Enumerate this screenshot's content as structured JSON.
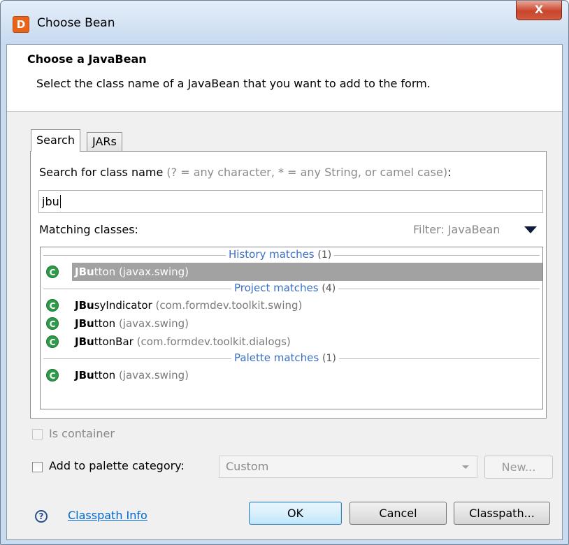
{
  "window": {
    "title": "Choose Bean",
    "app_icon_glyph": "D",
    "close_glyph": "X"
  },
  "header": {
    "title": "Choose a JavaBean",
    "description": "Select the class name of a JavaBean that you want to add to the form."
  },
  "tabs": [
    {
      "label": "Search",
      "active": true
    },
    {
      "label": "JARs",
      "active": false
    }
  ],
  "search": {
    "label": "Search for class name",
    "hint": "(? = any character, * = any String, or camel case)",
    "label_suffix": ":",
    "value": "jbu"
  },
  "matching": {
    "label": "Matching classes:",
    "filter_label": "Filter: JavaBean"
  },
  "results": [
    {
      "kind": "separator",
      "title": "History matches",
      "count": "(1)"
    },
    {
      "kind": "item",
      "match": "JBu",
      "rest": "tton",
      "package": "(javax.swing)",
      "selected": true
    },
    {
      "kind": "separator",
      "title": "Project matches",
      "count": "(4)"
    },
    {
      "kind": "item",
      "match": "JBu",
      "rest": "syIndicator",
      "package": "(com.formdev.toolkit.swing)",
      "selected": false
    },
    {
      "kind": "item",
      "match": "JBu",
      "rest": "tton",
      "package": "(javax.swing)",
      "selected": false
    },
    {
      "kind": "item",
      "match": "JBu",
      "rest": "ttonBar",
      "package": "(com.formdev.toolkit.dialogs)",
      "selected": false
    },
    {
      "kind": "separator",
      "title": "Palette matches",
      "count": "(1)"
    },
    {
      "kind": "item",
      "match": "JBu",
      "rest": "tton",
      "package": "(javax.swing)",
      "selected": false
    }
  ],
  "class_icon_glyph": "C",
  "options": {
    "is_container_label": "Is container",
    "add_to_palette_label": "Add to palette category:",
    "palette_category_value": "Custom",
    "new_button_label": "New..."
  },
  "footer": {
    "help_glyph": "?",
    "classpath_info_link": "Classpath Info",
    "ok_label": "OK",
    "cancel_label": "Cancel",
    "classpath_button_label": "Classpath..."
  },
  "colors": {
    "selection": "#a2a2a2",
    "separator_text": "#3a6fc5",
    "class_icon": "#2e9a4a",
    "link": "#0066cc"
  }
}
